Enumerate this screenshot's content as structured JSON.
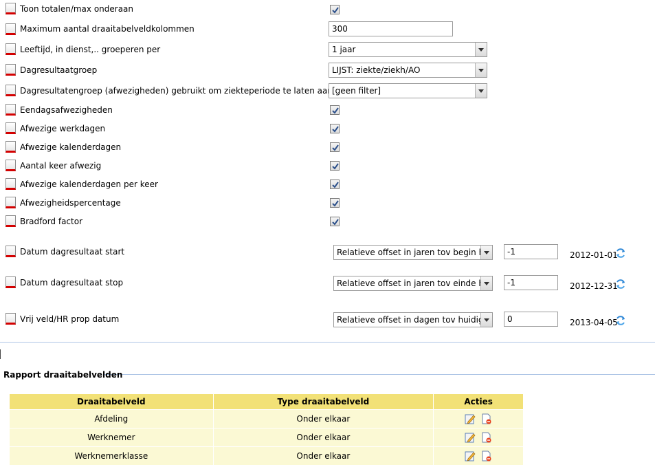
{
  "settings": {
    "show_totals_label": "Toon totalen/max onderaan",
    "max_columns_label": "Maximum aantal draaitabelveldkolommen",
    "max_columns_value": "300",
    "age_group_label": "Leeftijd, in dienst,.. groeperen per",
    "age_group_value": "1 jaar",
    "day_result_group_label": "Dagresultaatgroep",
    "day_result_group_value": "LIJST: ziekte/ziekh/AO",
    "absence_group_label": "Dagresultatengroep (afwezigheden) gebruikt om ziekteperiode te laten aansluiten",
    "absence_group_value": "[geen filter]",
    "one_day_label": "Eendagsafwezigheden",
    "work_days_label": "Afwezige werkdagen",
    "calendar_days_label": "Afwezige kalenderdagen",
    "times_absent_label": "Aantal keer afwezig",
    "calendar_days_per_time_label": "Afwezige kalenderdagen per keer",
    "absence_pct_label": "Afwezigheidspercentage",
    "bradford_label": "Bradford factor"
  },
  "dates": {
    "start": {
      "label": "Datum dagresultaat start",
      "select": "Relatieve offset in jaren tov begin huidig jaar",
      "offset": "-1",
      "date": "2012-01-01"
    },
    "stop": {
      "label": "Datum dagresultaat stop",
      "select": "Relatieve offset in jaren tov einde huidig jaar",
      "offset": "-1",
      "date": "2012-12-31"
    },
    "free": {
      "label": "Vrij veld/HR prop datum",
      "select": "Relatieve offset in dagen tov huidige datum",
      "offset": "0",
      "date": "2013-04-05"
    }
  },
  "report": {
    "legend": "Rapport draaitabelvelden",
    "headers": [
      "Draaitabelveld",
      "Type draaitabelveld",
      "Acties"
    ],
    "rows": [
      {
        "field": "Afdeling",
        "type": "Onder elkaar"
      },
      {
        "field": "Werknemer",
        "type": "Onder elkaar"
      },
      {
        "field": "Werknemerklasse",
        "type": "Onder elkaar"
      }
    ]
  },
  "icons": {
    "check": "checkmark-icon",
    "refresh": "refresh-icon",
    "edit": "edit-icon",
    "delete": "delete-icon"
  },
  "colors": {
    "header_bg": "#f2e177",
    "row_bg": "#fbf9d4",
    "lock_marker": "#d40000",
    "divider": "#aec6e6"
  }
}
